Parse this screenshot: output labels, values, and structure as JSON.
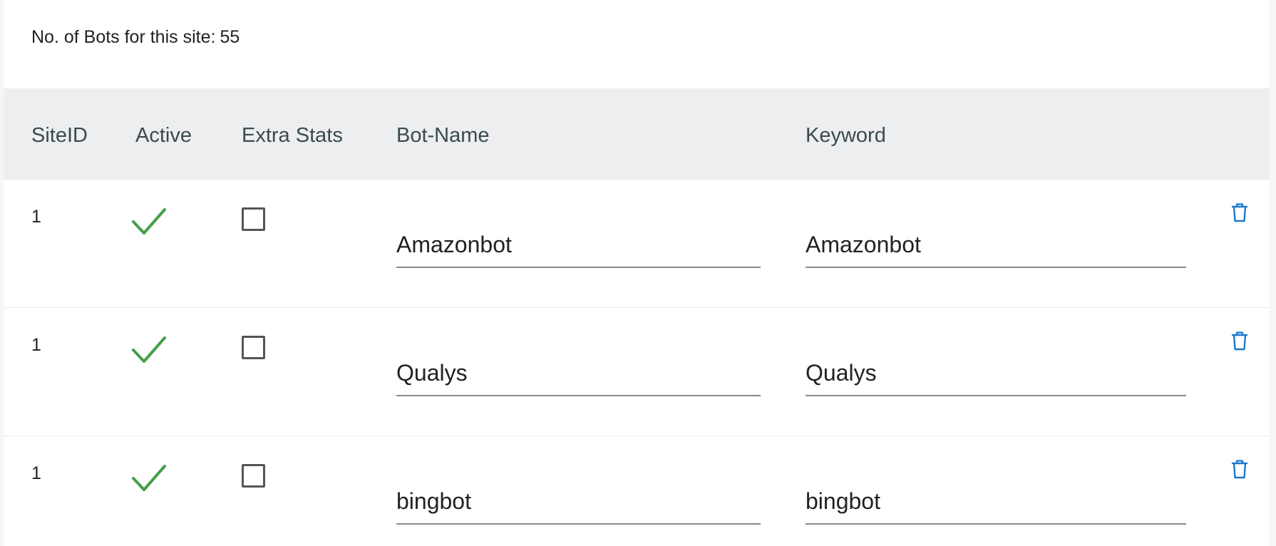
{
  "summary": {
    "label": "No. of Bots for this site:",
    "count": "55"
  },
  "columns": {
    "site_id": "SiteID",
    "active": "Active",
    "extra_stats": "Extra Stats",
    "bot_name": "Bot-Name",
    "keyword": "Keyword"
  },
  "rows": [
    {
      "site_id": "1",
      "active": true,
      "extra_stats": false,
      "bot_name": "Amazonbot",
      "keyword": "Amazonbot"
    },
    {
      "site_id": "1",
      "active": true,
      "extra_stats": false,
      "bot_name": "Qualys",
      "keyword": "Qualys"
    },
    {
      "site_id": "1",
      "active": true,
      "extra_stats": false,
      "bot_name": "bingbot",
      "keyword": "bingbot"
    }
  ],
  "icons": {
    "active": "check-icon",
    "delete": "trash-icon"
  },
  "colors": {
    "check": "#43a047",
    "trash": "#1e78c8",
    "header_bg": "#eceef0",
    "header_text": "#3a4a52"
  }
}
